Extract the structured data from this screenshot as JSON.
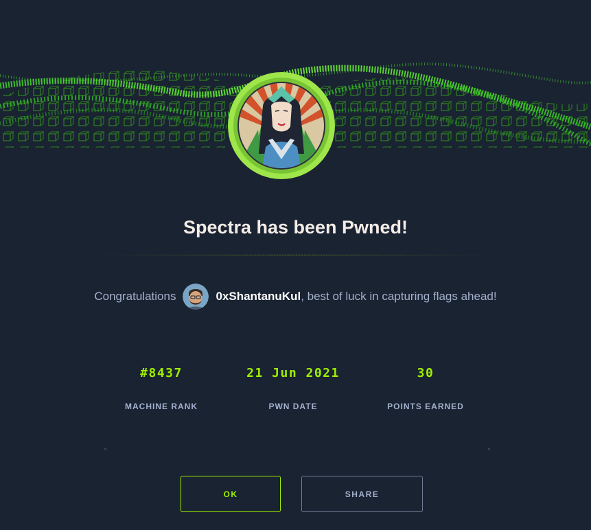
{
  "dialog": {
    "machine_name": "Spectra",
    "title": "Spectra has been Pwned!",
    "congrats_prefix": "Congratulations",
    "username": "0xShantanuKul",
    "congrats_suffix": ", best of luck in capturing flags ahead!"
  },
  "stats": [
    {
      "value": "#8437",
      "label": "MACHINE RANK"
    },
    {
      "value": "21 Jun 2021",
      "label": "PWN DATE"
    },
    {
      "value": "30",
      "label": "POINTS EARNED"
    }
  ],
  "buttons": {
    "ok_label": "OK",
    "share_label": "SHARE"
  },
  "colors": {
    "background": "#1a2332",
    "accent": "#9fef00",
    "text_muted": "#a4b1cd",
    "title": "#f3ece6"
  }
}
